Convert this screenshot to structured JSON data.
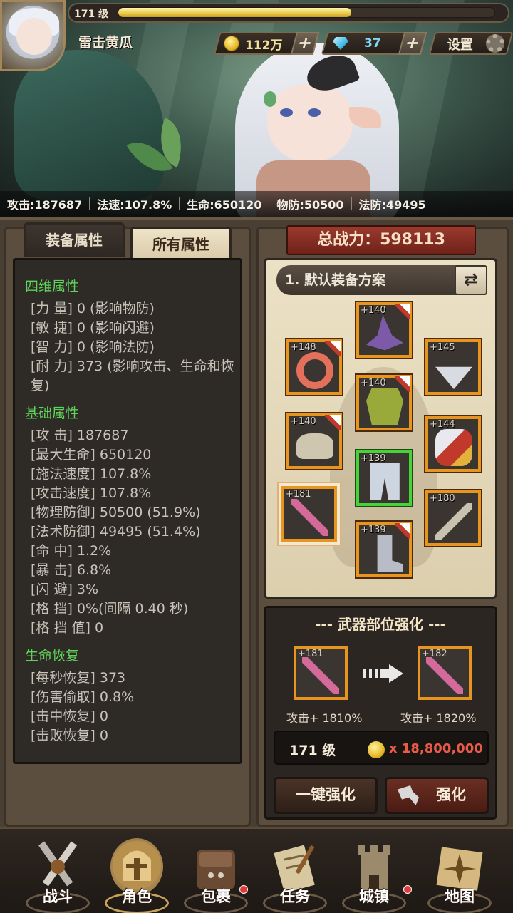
{
  "header": {
    "level": "171 级",
    "xp_progress": 0.62,
    "player_name": "雷击黄瓜",
    "gold": "112万",
    "diamonds": "37",
    "settings_label": "设置",
    "plus_label": "+"
  },
  "stat_strip": [
    "攻击:187687",
    "法速:107.8%",
    "生命:650120",
    "物防:50500",
    "法防:49495"
  ],
  "tabs": {
    "equip_attrs": "装备属性",
    "all_attrs": "所有属性"
  },
  "attributes": {
    "four_dim_title": "四维属性",
    "four_dim": [
      "[力  量] 0 (影响物防)",
      "[敏  捷] 0 (影响闪避)",
      "[智  力] 0 (影响法防)",
      "[耐  力] 373 (影响攻击、生命和恢复)"
    ],
    "base_title": "基础属性",
    "base": [
      "[攻      击] 187687",
      "[最大生命] 650120",
      "[施法速度] 107.8%",
      "[攻击速度] 107.8%",
      "[物理防御] 50500 (51.9%)",
      "[法术防御] 49495 (51.4%)",
      "[命      中] 1.2%",
      "[暴      击] 6.8%",
      "[闪      避] 3%",
      "[格      挡] 0%(间隔 0.40 秒)",
      "[格 挡 值] 0"
    ],
    "regen_title": "生命恢复",
    "regen": [
      "[每秒恢复] 373",
      "[伤害偷取] 0.8%",
      "[击中恢复] 0",
      "[击败恢复] 0"
    ]
  },
  "power": {
    "label": "总战力：598113"
  },
  "equipment": {
    "scheme_label": "1. 默认装备方案",
    "swap_icon": "⇄",
    "slots": [
      {
        "name": "hat",
        "level": "+140",
        "color": "#7d5aa8"
      },
      {
        "name": "ring",
        "level": "+148",
        "color": "#e2705a"
      },
      {
        "name": "necklace",
        "level": "+145",
        "color": "#d8dce2"
      },
      {
        "name": "armor",
        "level": "+140",
        "color": "#9aaa3a"
      },
      {
        "name": "pauldron",
        "level": "+140",
        "color": "#cfc6b0"
      },
      {
        "name": "gauntlet",
        "level": "+144",
        "color": "#c0392b"
      },
      {
        "name": "pants",
        "level": "+139",
        "color": "#cdd5e0"
      },
      {
        "name": "weapon",
        "level": "+181",
        "color": "#d46a9a"
      },
      {
        "name": "offhand",
        "level": "+180",
        "color": "#c9c2b0"
      },
      {
        "name": "boots",
        "level": "+139",
        "color": "#b8bcc6"
      }
    ]
  },
  "enhance": {
    "title": "--- 武器部位强化 ---",
    "current_level": "+181",
    "next_level": "+182",
    "current_effect": "攻击+ 1810%",
    "next_effect": "攻击+ 1820%",
    "cost_level": "171 级",
    "cost_amount": "x 18,800,000",
    "auto_btn": "一键强化",
    "enh_btn": "强化"
  },
  "nav": [
    {
      "label": "战斗",
      "icon": "crossed-swords-icon",
      "dot": false,
      "active": false
    },
    {
      "label": "角色",
      "icon": "helmet-icon",
      "dot": false,
      "active": true
    },
    {
      "label": "包裹",
      "icon": "backpack-icon",
      "dot": true,
      "active": false
    },
    {
      "label": "任务",
      "icon": "scroll-icon",
      "dot": false,
      "active": false
    },
    {
      "label": "城镇",
      "icon": "castle-tower-icon",
      "dot": true,
      "active": false
    },
    {
      "label": "地图",
      "icon": "map-compass-icon",
      "dot": false,
      "active": false
    }
  ]
}
